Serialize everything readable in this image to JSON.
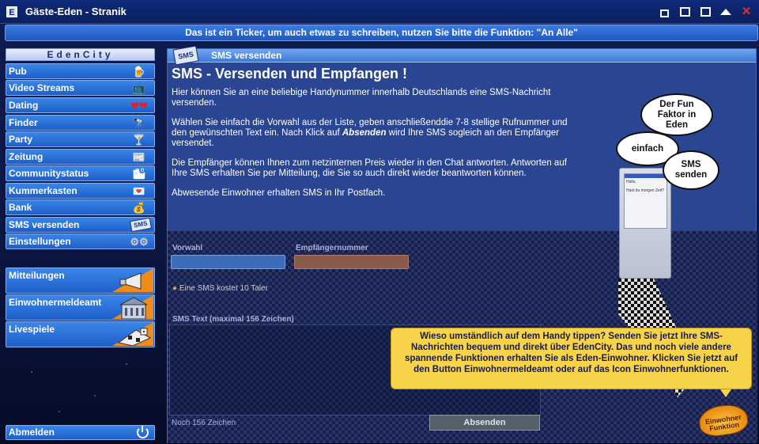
{
  "window": {
    "title": "Gäste-Eden - Stranik",
    "app_icon": "E"
  },
  "ticker": {
    "text": "Das ist ein Ticker, um auch etwas zu schreiben, nutzen Sie bitte die Funktion: \"An Alle\""
  },
  "sidebar": {
    "header": "EdenCity",
    "items": [
      {
        "label": "Pub",
        "icon": "beer-mug-icon",
        "glyph": "🍺"
      },
      {
        "label": "Video Streams",
        "icon": "tv-icon",
        "glyph": "📺"
      },
      {
        "label": "Dating",
        "icon": "hearts-icon",
        "glyph": "❤❤"
      },
      {
        "label": "Finder",
        "icon": "spyglass-icon",
        "glyph": "🔭"
      },
      {
        "label": "Party",
        "icon": "cocktail-icon",
        "glyph": "🍸"
      },
      {
        "label": "Zeitung",
        "icon": "newspaper-icon",
        "glyph": "📰"
      },
      {
        "label": "Communitystatus",
        "icon": "community-icon",
        "glyph": "🏙"
      },
      {
        "label": "Kummerkasten",
        "icon": "heart-box-icon",
        "glyph": "💌"
      },
      {
        "label": "Bank",
        "icon": "money-bag-icon",
        "glyph": "💰"
      },
      {
        "label": "SMS versenden",
        "icon": "sms-icon",
        "glyph": "SMS"
      },
      {
        "label": "Einstellungen",
        "icon": "gears-icon",
        "glyph": "⚙⚙"
      }
    ],
    "big_items": [
      {
        "label": "Mitteilungen",
        "icon": "megaphone-icon"
      },
      {
        "label": "Einwohnermeldeamt",
        "icon": "town-hall-icon"
      },
      {
        "label": "Livespiele",
        "icon": "games-icon"
      }
    ],
    "logout": "Abmelden"
  },
  "main": {
    "header_title": "SMS versenden",
    "header_icon_text": "SMS",
    "page_title": "SMS - Versenden und Empfangen !",
    "paragraphs": [
      "Hier können Sie an eine beliebige Handynummer innerhalb Deutschlands eine SMS-Nachricht versenden.",
      "Wählen Sie einfach die Vorwahl aus der Liste, geben anschließenddie 7-8 stellige Rufnummer und den gewünschten Text ein. Nach Klick auf",
      "wird Ihre SMS sogleich an den Empfänger versendet.",
      "Die Empfänger können Ihnen zum netzinternen Preis wieder in den Chat antworten. Antworten auf Ihre SMS erhalten Sie per Mitteilung, die Sie so auch direkt wieder beantworten können.",
      "Abwesende Einwohner erhalten SMS in Ihr Postfach."
    ],
    "emphasis": "Absenden",
    "bubbles": {
      "b1": "Der Fun Faktor in Eden",
      "b2": "einfach",
      "b3": "SMS senden"
    },
    "phone_screen": {
      "line1": "Hallo,",
      "line2": "Hast du morgen Zeit?"
    }
  },
  "form": {
    "vorwahl_label": "Vorwahl",
    "rufnummer_label": "Empfängernummer",
    "note": "Eine SMS kostet 10 Taler",
    "text_label": "SMS Text (maximal 156 Zeichen)",
    "remaining_label": "Noch 156 Zeichen",
    "send_button": "Absenden"
  },
  "tooltip": {
    "text": "Wieso umständlich auf dem Handy tippen? Senden Sie jetzt Ihre SMS-Nachrichten bequem und direkt über EdenCity. Das und noch viele andere spannende Funktionen erhalten Sie als Eden-Einwohner. Klicken Sie jetzt auf den Button Einwohnermeldeamt oder auf das Icon Einwohnerfunktionen."
  },
  "badge": {
    "line1": "Einwohner",
    "line2": "Funktion"
  },
  "colors": {
    "accent": "#1e5fc8",
    "ticker": "#2a66d0",
    "tooltip": "#f7d349",
    "panel": "#2a4591"
  }
}
